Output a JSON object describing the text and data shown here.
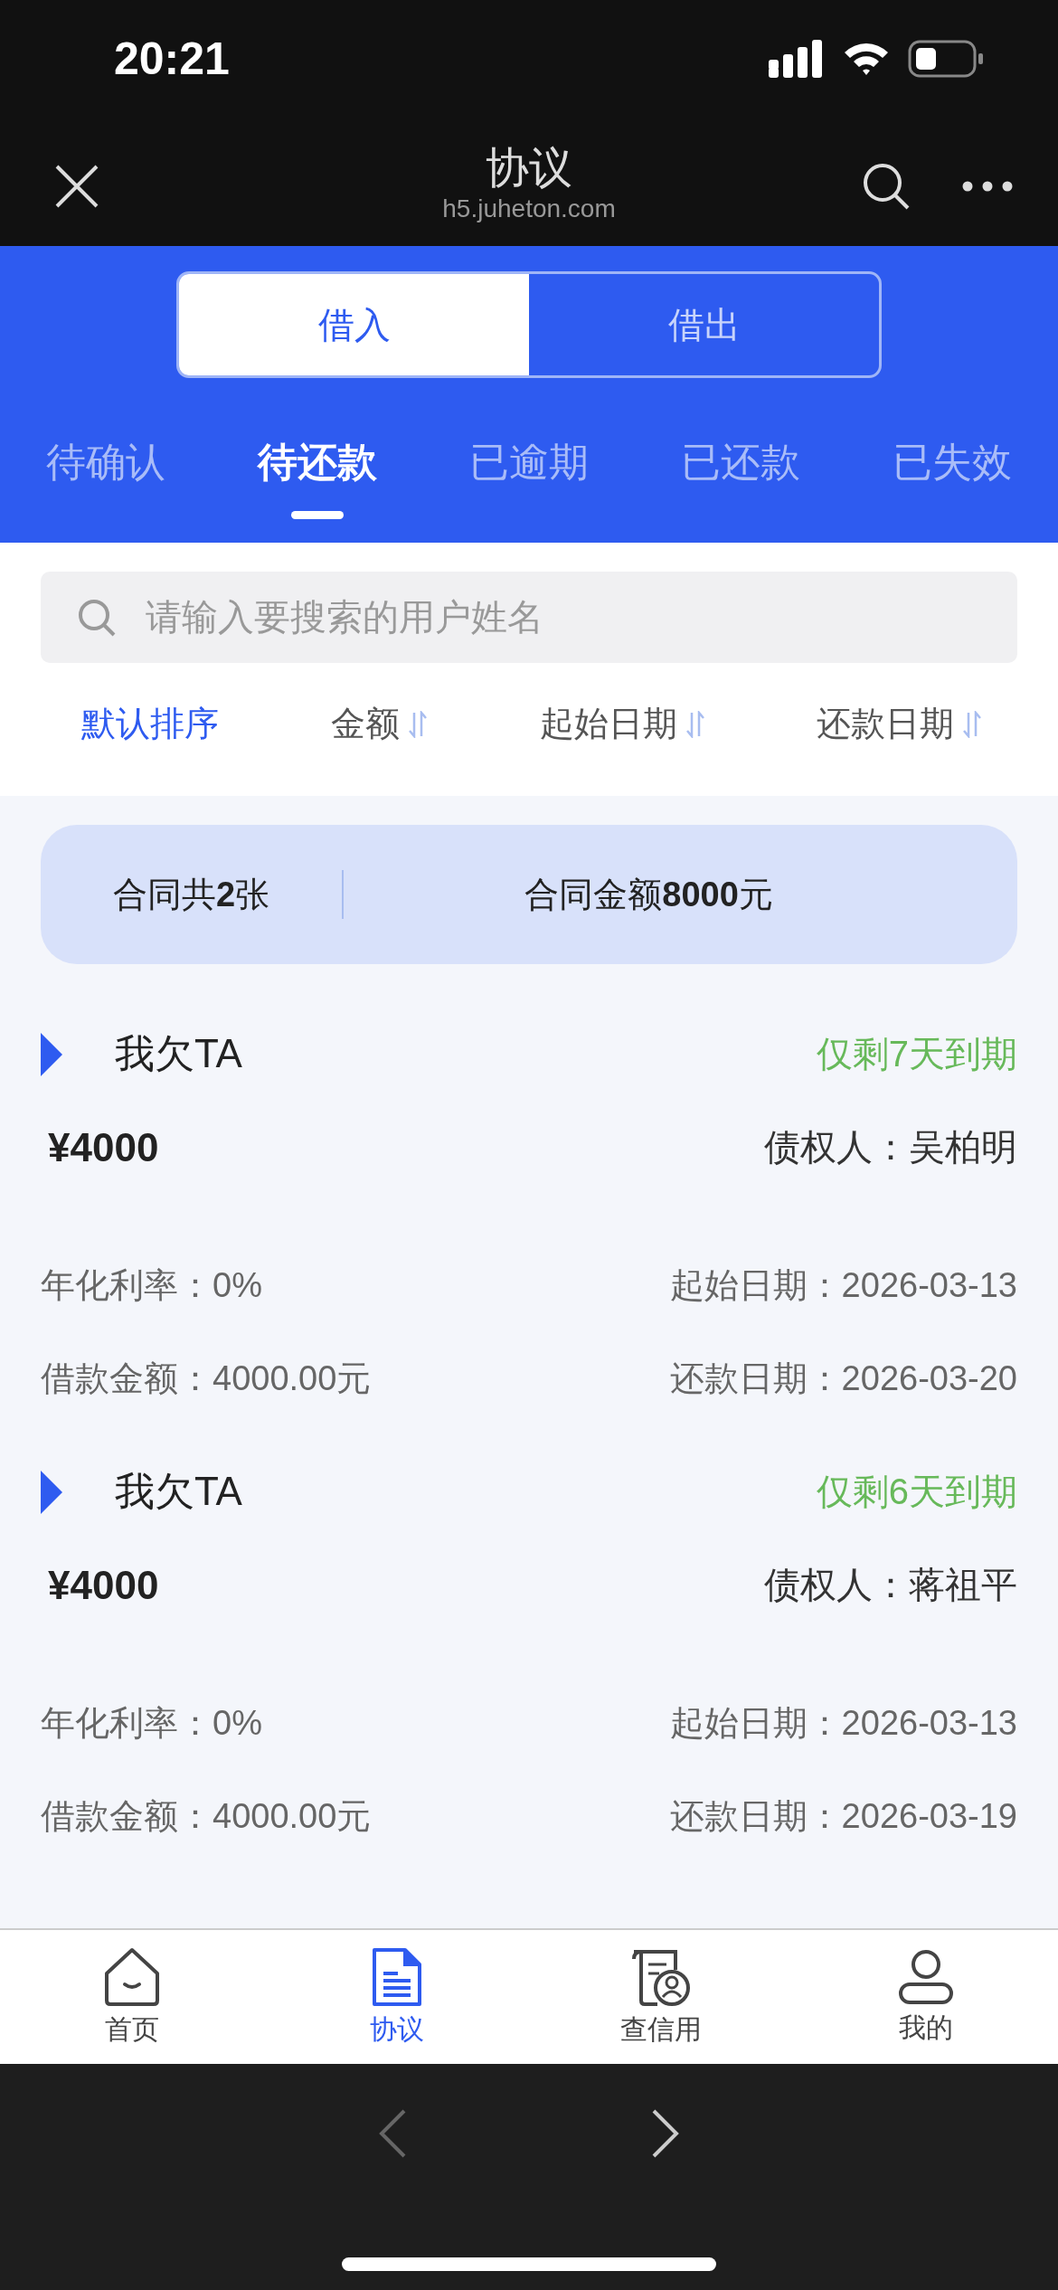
{
  "status_bar": {
    "time": "20:21"
  },
  "nav_bar": {
    "title": "协议",
    "url": "h5.juheton.com"
  },
  "segments": [
    {
      "label": "借入",
      "selected": true
    },
    {
      "label": "借出",
      "selected": false
    }
  ],
  "tabs": [
    {
      "label": "待确认",
      "selected": false
    },
    {
      "label": "待还款",
      "selected": true
    },
    {
      "label": "已逾期",
      "selected": false
    },
    {
      "label": "已还款",
      "selected": false
    },
    {
      "label": "已失效",
      "selected": false
    }
  ],
  "search": {
    "placeholder": "请输入要搜索的用户姓名"
  },
  "sort_options": [
    {
      "label": "默认排序",
      "selected": true,
      "kind": "plain"
    },
    {
      "label": "金额",
      "selected": false,
      "kind": "sortable"
    },
    {
      "label": "起始日期",
      "selected": false,
      "kind": "sortable"
    },
    {
      "label": "还款日期",
      "selected": false,
      "kind": "sortable"
    }
  ],
  "summary": {
    "count": "合同共**2**张",
    "total": "合同金额**8000**元"
  },
  "contracts": [
    {
      "direction": "我欠TA",
      "due": "仅剩7天到期",
      "amount": "¥4000",
      "creditor": "债权人：吴柏明",
      "rate": "年化利率：0%",
      "start_date": "起始日期：2026-03-13",
      "loan_amount": "借款金额：4000.00元",
      "repay_date": "还款日期：2026-03-20"
    },
    {
      "direction": "我欠TA",
      "due": "仅剩6天到期",
      "amount": "¥4000",
      "creditor": "债权人：蒋祖平",
      "rate": "年化利率：0%",
      "start_date": "起始日期：2026-03-13",
      "loan_amount": "借款金额：4000.00元",
      "repay_date": "还款日期：2026-03-19"
    }
  ],
  "tab_bar": [
    {
      "label": "首页",
      "kind": "home",
      "selected": false
    },
    {
      "label": "协议",
      "kind": "document",
      "selected": true
    },
    {
      "label": "查信用",
      "kind": "credit",
      "selected": false
    },
    {
      "label": "我的",
      "kind": "profile",
      "selected": false
    }
  ]
}
